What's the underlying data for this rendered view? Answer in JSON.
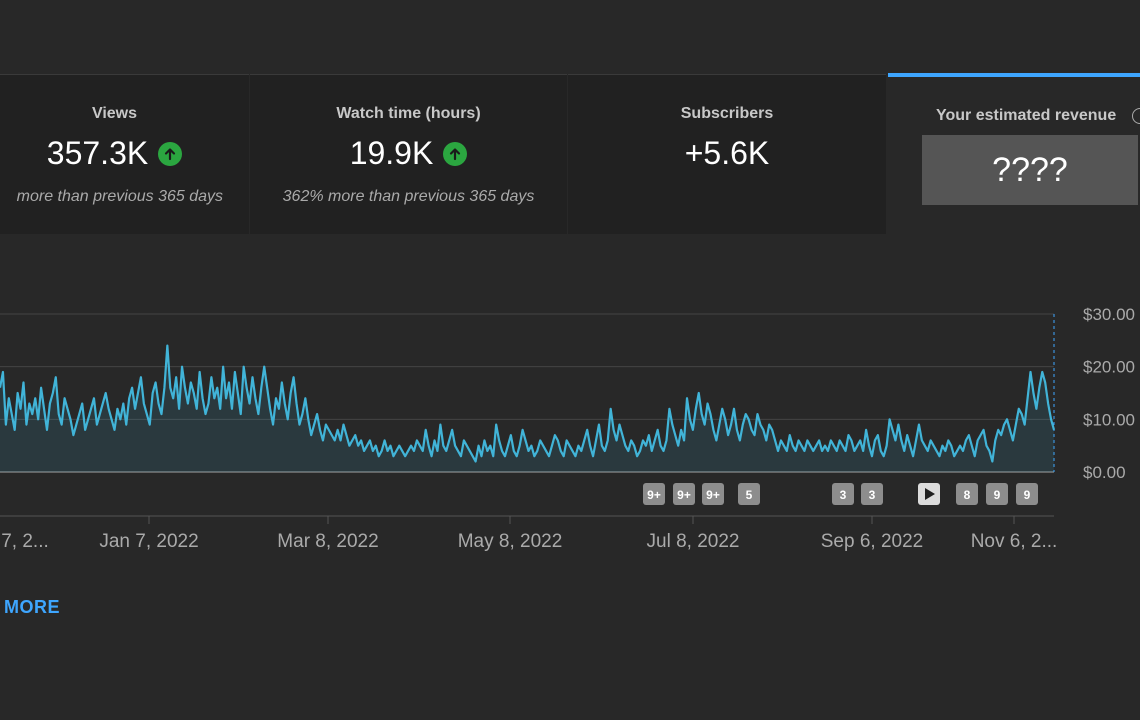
{
  "metrics": {
    "views": {
      "title": "Views",
      "value": "357.3K",
      "sub": "more than previous 365 days",
      "trend_icon": "arrow-up-circle-icon"
    },
    "watch_time": {
      "title": "Watch time (hours)",
      "value": "19.9K",
      "sub": "362% more than previous 365 days",
      "trend_icon": "arrow-up-circle-icon"
    },
    "subscribers": {
      "title": "Subscribers",
      "value": "+5.6K"
    },
    "revenue": {
      "title": "Your estimated revenue",
      "value": "????",
      "info_icon": "info-icon"
    }
  },
  "colors": {
    "accent": "#3ea6ff",
    "line": "#41b4d8",
    "up": "#2ba640"
  },
  "chart_data": {
    "type": "line",
    "x_start": "2021-12-08",
    "x_end": "2022-11-19",
    "x_tick_labels": [
      "7, 2...",
      "Jan 7, 2022",
      "Mar 8, 2022",
      "May 8, 2022",
      "Jul 8, 2022",
      "Sep 6, 2022",
      "Nov 6, 2..."
    ],
    "y_tick_labels": [
      "$0.00",
      "$10.00",
      "$20.00",
      "$30.00"
    ],
    "ylim": [
      0,
      30
    ],
    "series": [
      {
        "values": [
          16,
          19,
          9,
          14,
          11,
          8,
          15,
          12,
          17,
          9,
          13,
          11,
          14,
          10,
          16,
          12,
          8,
          13,
          15,
          18,
          11,
          9,
          14,
          12,
          10,
          7,
          9,
          11,
          13,
          8,
          10,
          12,
          14,
          9,
          11,
          13,
          15,
          12,
          10,
          8,
          12,
          10,
          13,
          9,
          14,
          16,
          12,
          15,
          18,
          13,
          11,
          9,
          15,
          17,
          13,
          11,
          16,
          24,
          16,
          14,
          18,
          12,
          20,
          16,
          13,
          17,
          15,
          12,
          19,
          14,
          11,
          13,
          18,
          14,
          16,
          12,
          20,
          14,
          17,
          12,
          19,
          15,
          11,
          20,
          16,
          13,
          18,
          14,
          11,
          16,
          20,
          16,
          12,
          9,
          14,
          12,
          17,
          13,
          10,
          15,
          18,
          13,
          9,
          11,
          14,
          10,
          7,
          9,
          11,
          8,
          6,
          9,
          8,
          7,
          6,
          8,
          6,
          9,
          7,
          5,
          6,
          7,
          5,
          6,
          4,
          5,
          6,
          4,
          5,
          3,
          4,
          6,
          4,
          5,
          3,
          4,
          5,
          4,
          3,
          4,
          5,
          4,
          6,
          5,
          4,
          8,
          5,
          3,
          6,
          4,
          9,
          5,
          4,
          6,
          8,
          5,
          4,
          3,
          6,
          5,
          4,
          3,
          2,
          5,
          3,
          6,
          4,
          5,
          3,
          9,
          6,
          4,
          3,
          5,
          7,
          4,
          3,
          5,
          8,
          6,
          4,
          5,
          3,
          4,
          6,
          5,
          4,
          3,
          5,
          7,
          6,
          4,
          3,
          6,
          5,
          4,
          3,
          5,
          4,
          6,
          8,
          5,
          3,
          6,
          9,
          5,
          4,
          6,
          12,
          8,
          6,
          9,
          7,
          5,
          4,
          6,
          5,
          3,
          4,
          6,
          5,
          7,
          4,
          6,
          8,
          5,
          4,
          6,
          12,
          9,
          7,
          5,
          8,
          6,
          14,
          10,
          8,
          12,
          15,
          11,
          9,
          13,
          11,
          8,
          6,
          9,
          12,
          10,
          7,
          9,
          12,
          8,
          6,
          9,
          11,
          10,
          8,
          7,
          11,
          9,
          8,
          6,
          9,
          8,
          6,
          4,
          6,
          5,
          4,
          7,
          5,
          4,
          6,
          5,
          4,
          6,
          5,
          4,
          5,
          6,
          4,
          5,
          4,
          6,
          5,
          4,
          6,
          5,
          4,
          7,
          6,
          4,
          5,
          6,
          4,
          8,
          5,
          3,
          6,
          7,
          4,
          3,
          5,
          10,
          8,
          6,
          9,
          6,
          4,
          7,
          5,
          3,
          6,
          9,
          6,
          5,
          4,
          6,
          5,
          4,
          3,
          5,
          4,
          6,
          5,
          3,
          4,
          5,
          4,
          6,
          7,
          5,
          3,
          6,
          7,
          8,
          5,
          4,
          2,
          6,
          8,
          7,
          9,
          10,
          8,
          6,
          9,
          12,
          11,
          9,
          14,
          19,
          15,
          12,
          16,
          19,
          17,
          13,
          10,
          8
        ]
      }
    ],
    "event_markers": [
      "9+",
      "9+",
      "9+",
      "5",
      "3",
      "3",
      "play",
      "8",
      "9",
      "9"
    ]
  },
  "footer": {
    "more_label": "MORE"
  }
}
